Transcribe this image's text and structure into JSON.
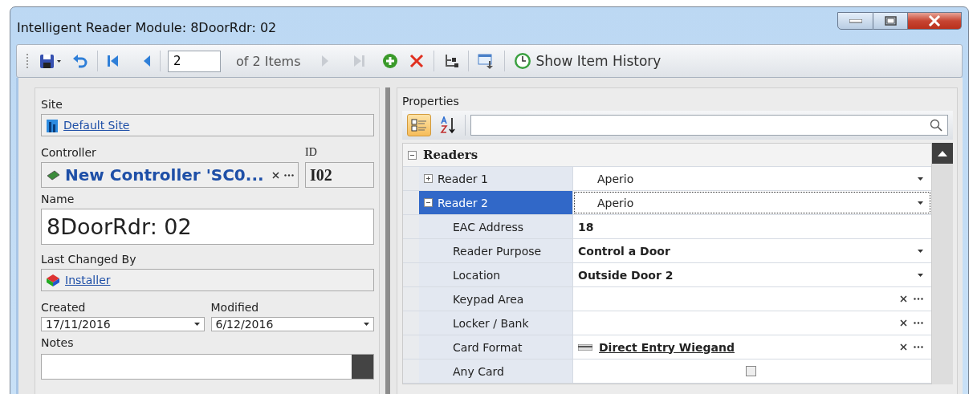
{
  "window": {
    "title": "Intelligent Reader Module: 8DoorRdr: 02"
  },
  "toolbar": {
    "page": "2",
    "page_count": "of 2 Items",
    "history_button": "Show Item History",
    "next_disabled": true,
    "last_disabled": true
  },
  "details": {
    "site_label": "Site",
    "site": "Default Site",
    "controller_label": "Controller",
    "controller": "New Controller 'SC0...",
    "id_label": "ID",
    "id": "I02",
    "name_label": "Name",
    "name": "8DoorRdr: 02",
    "changed_label": "Last Changed By",
    "changed_by": "Installer",
    "created_label": "Created",
    "created": "17/11/2016",
    "modified_label": "Modified",
    "modified": "6/12/2016",
    "notes_label": "Notes"
  },
  "properties": {
    "title": "Properties",
    "categorized_selected": true,
    "rows": [
      {
        "kind": "category",
        "name": "Readers",
        "expanded": true
      },
      {
        "kind": "group",
        "name": "Reader 1",
        "value": "Aperio",
        "expanded": false,
        "selected": false
      },
      {
        "kind": "group",
        "name": "Reader 2",
        "value": "Aperio",
        "expanded": true,
        "selected": true
      },
      {
        "kind": "text",
        "name": "EAC Address",
        "value": "18"
      },
      {
        "kind": "dropdown",
        "name": "Reader Purpose",
        "value": "Control a Door"
      },
      {
        "kind": "dropdown",
        "name": "Location",
        "value": "Outside Door 2"
      },
      {
        "kind": "lookup",
        "name": "Keypad Area"
      },
      {
        "kind": "lookup",
        "name": "Locker / Bank"
      },
      {
        "kind": "link",
        "name": "Card Format",
        "value": "Direct Entry Wiegand"
      },
      {
        "kind": "checkbox",
        "name": "Any Card",
        "checked": false
      }
    ]
  }
}
